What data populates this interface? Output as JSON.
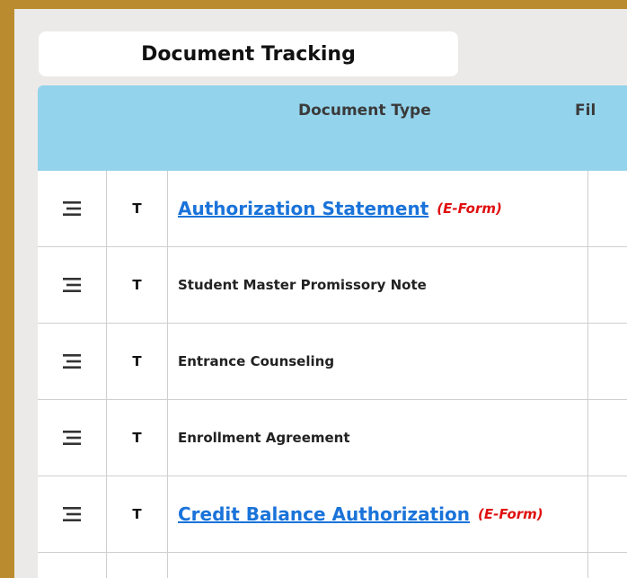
{
  "header": {
    "title": "Document Tracking"
  },
  "table": {
    "columns": {
      "document_type": "Document Type",
      "file": "Fil"
    },
    "rows": [
      {
        "type_code": "T",
        "name": "Authorization Statement",
        "link": true,
        "eform": "(E-Form)"
      },
      {
        "type_code": "T",
        "name": "Student Master Promissory Note",
        "link": false
      },
      {
        "type_code": "T",
        "name": "Entrance Counseling",
        "link": false
      },
      {
        "type_code": "T",
        "name": "Enrollment Agreement",
        "link": false
      },
      {
        "type_code": "T",
        "name": "Credit Balance Authorization",
        "link": true,
        "eform": "(E-Form)"
      }
    ]
  },
  "icons": {
    "row_handle": "menu-lines-icon"
  },
  "colors": {
    "background": "#bb8c2f",
    "panel": "#eceae8",
    "header": "#93d3ec",
    "link": "#1a73d9",
    "eform": "#e01010"
  }
}
